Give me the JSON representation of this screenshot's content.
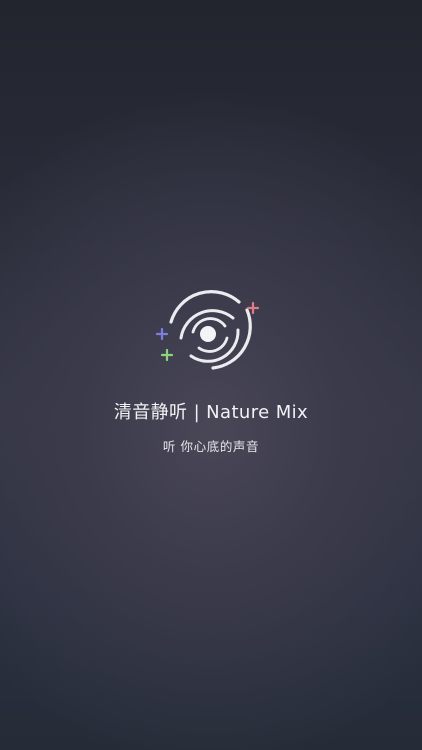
{
  "app": {
    "title": "清音静听 | Nature Mix",
    "slogan": "听 你心底的声音"
  },
  "logo": {
    "icon": "galaxy-swirl-icon",
    "accent_colors": {
      "plus_top_right": "#e07a84",
      "plus_left": "#7c7fe0",
      "plus_bottom_left": "#8ed47e"
    }
  },
  "theme": {
    "background": "#2b2e3b",
    "text": "#f2f2f5"
  }
}
